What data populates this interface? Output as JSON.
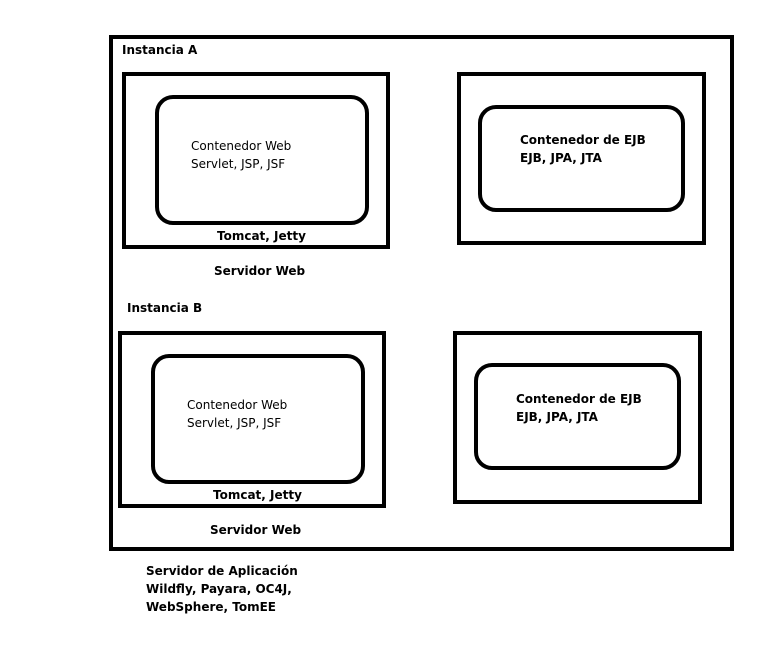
{
  "diagram": {
    "outer": {
      "caption_line1": "Servidor de Aplicación",
      "caption_line2": "Wildfly, Payara, OC4J,",
      "caption_line3": "WebSphere, TomEE"
    },
    "instance_a": {
      "label": "Instancia A",
      "web_server": {
        "container_line1": "Contenedor Web",
        "container_line2": "Servlet, JSP, JSF",
        "impl": "Tomcat, Jetty",
        "caption": "Servidor Web"
      },
      "ejb": {
        "container_line1": "Contenedor de EJB",
        "container_line2": "EJB, JPA, JTA"
      }
    },
    "instance_b": {
      "label": "Instancia B",
      "web_server": {
        "container_line1": "Contenedor Web",
        "container_line2": "Servlet, JSP, JSF",
        "impl": "Tomcat, Jetty",
        "caption": "Servidor Web"
      },
      "ejb": {
        "container_line1": "Contenedor de EJB",
        "container_line2": "EJB, JPA, JTA"
      }
    }
  }
}
